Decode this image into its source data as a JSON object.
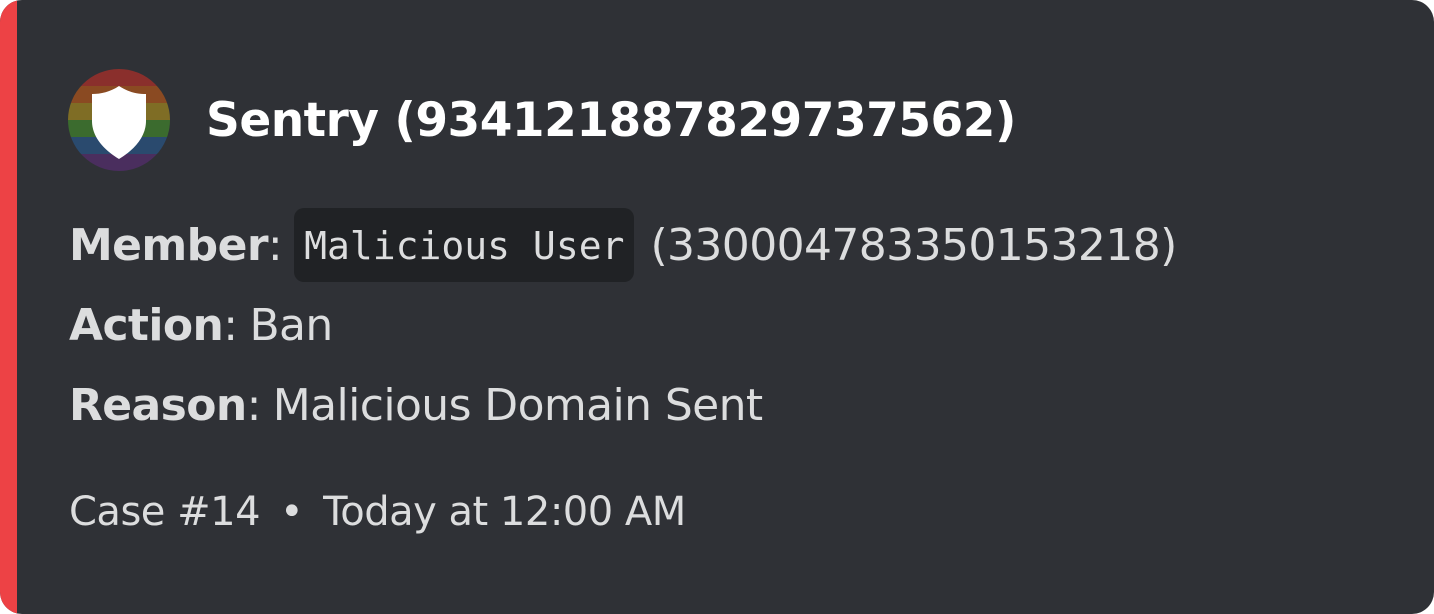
{
  "colors": {
    "accent": "#ed4245",
    "embed_background": "#2f3136",
    "code_background": "#202225"
  },
  "author": {
    "name": "Sentry (934121887829737562)",
    "avatar_icon": "shield-icon"
  },
  "fields": [
    {
      "name": "Member",
      "code_value": "Malicious User",
      "value": "(330004783350153218)"
    },
    {
      "name": "Action",
      "value": "Ban"
    },
    {
      "name": "Reason",
      "value": "Malicious Domain Sent"
    }
  ],
  "footer": {
    "case": "Case #14",
    "separator": "•",
    "timestamp": "Today at 12:00 AM"
  }
}
